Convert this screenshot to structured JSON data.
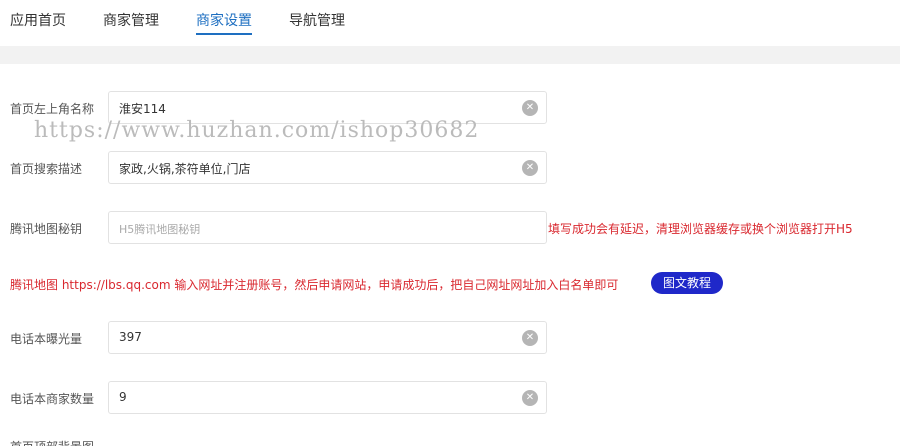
{
  "tabs": [
    {
      "label": "应用首页"
    },
    {
      "label": "商家管理"
    },
    {
      "label": "商家设置"
    },
    {
      "label": "导航管理"
    }
  ],
  "form": {
    "top_left_name": {
      "label": "首页左上角名称",
      "value": "淮安114"
    },
    "search_desc": {
      "label": "首页搜索描述",
      "value": "家政,火锅,茶符单位,门店"
    },
    "map_key": {
      "label": "腾讯地图秘钥",
      "placeholder": "H5腾讯地图秘钥",
      "hint": "填写成功会有延迟，清理浏览器缓存或换个浏览器打开H5"
    },
    "map_notice": "腾讯地图 https://lbs.qq.com 输入网址并注册账号，然后申请网站，申请成功后，把自己网址网址加入白名单即可",
    "tutorial_button": "图文教程",
    "phone_exposure": {
      "label": "电话本曝光量",
      "value": "397"
    },
    "phone_merchants": {
      "label": "电话本商家数量",
      "value": "9"
    },
    "cut_label": "首页顶部背景图"
  },
  "watermark": "https://www.huzhan.com/ishop30682",
  "colors": {
    "accent": "#1e6fc1",
    "warning": "#d9282f",
    "button": "#1f28c9"
  }
}
